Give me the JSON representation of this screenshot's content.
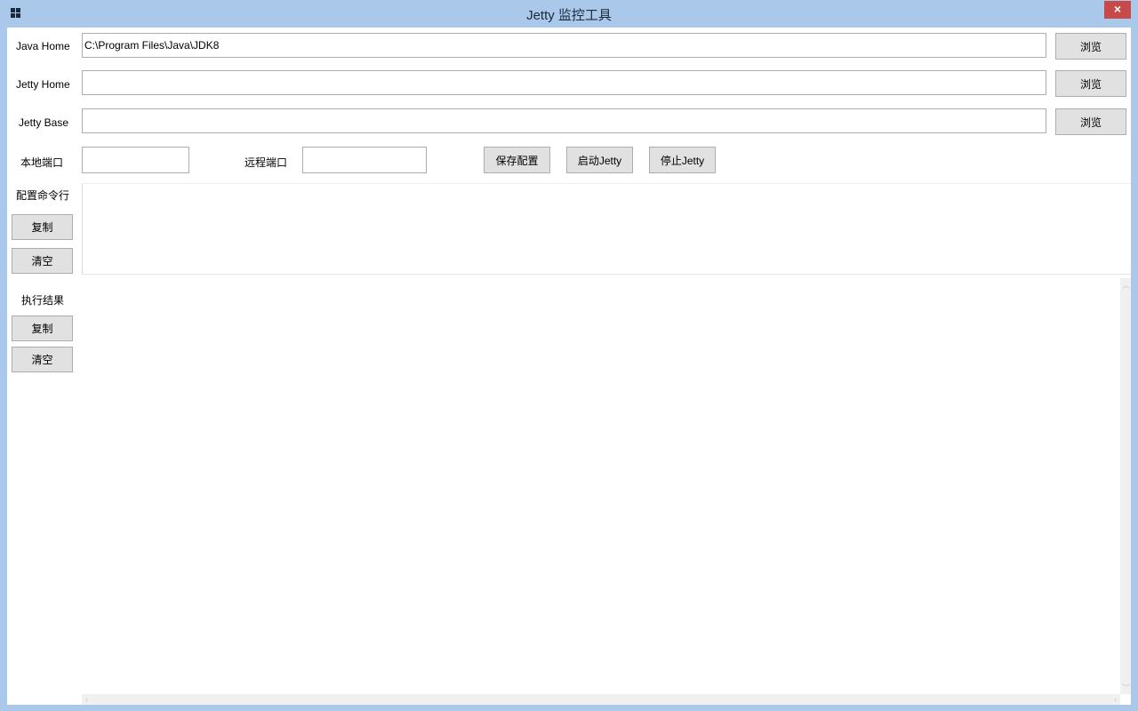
{
  "window": {
    "title": "Jetty 监控工具",
    "close_symbol": "×"
  },
  "form": {
    "java_home": {
      "label": "Java Home",
      "value": "C:\\Program Files\\Java\\JDK8",
      "browse_label": "浏览"
    },
    "jetty_home": {
      "label": "Jetty Home",
      "value": "",
      "browse_label": "浏览"
    },
    "jetty_base": {
      "label": "Jetty Base",
      "value": "",
      "browse_label": "浏览"
    },
    "local_port": {
      "label": "本地端口",
      "value": ""
    },
    "remote_port": {
      "label": "远程端口",
      "value": ""
    },
    "save_config_label": "保存配置",
    "start_jetty_label": "启动Jetty",
    "stop_jetty_label": "停止Jetty"
  },
  "config_cmd": {
    "label": "配置命令行",
    "copy_label": "复制",
    "clear_label": "清空",
    "text": ""
  },
  "result": {
    "label": "执行结果",
    "copy_label": "复制",
    "clear_label": "清空",
    "text": ""
  },
  "colors": {
    "titlebar": "#a9c8ea",
    "close_button": "#c74a4a",
    "button_face": "#e1e1e1"
  },
  "icons": {
    "app": "app-grid-icon",
    "close": "close-icon",
    "scroll_up": "scroll-up-arrow-icon",
    "scroll_down": "scroll-down-arrow-icon",
    "scroll_left": "scroll-left-arrow-icon",
    "scroll_right": "scroll-right-arrow-icon"
  }
}
